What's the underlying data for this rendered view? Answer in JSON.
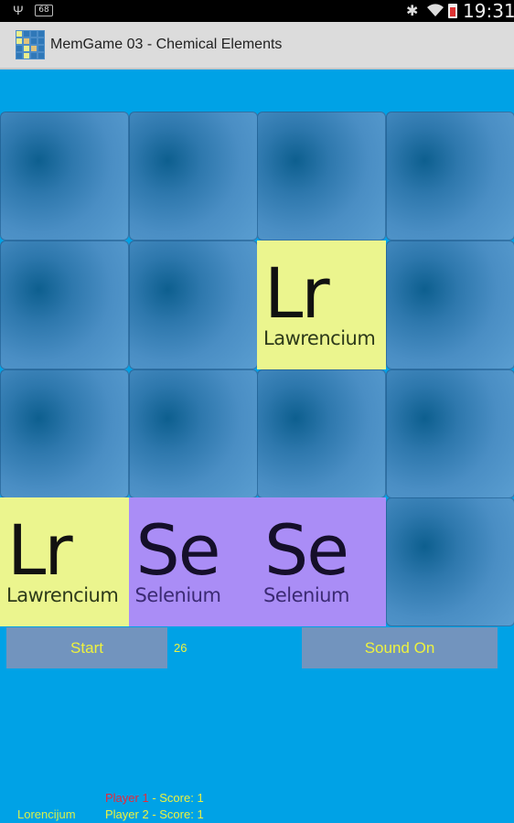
{
  "status_bar": {
    "notification_count": "68",
    "time": "19:31",
    "icons": [
      "usb-icon",
      "notification-icon",
      "bluetooth-icon",
      "wifi-icon",
      "battery-icon"
    ]
  },
  "app": {
    "title": "MemGame 03 - Chemical Elements",
    "icon": "app-icon"
  },
  "board": {
    "rows": 4,
    "cols": 4,
    "tiles": [
      {
        "row": 0,
        "col": 0,
        "state": "hidden"
      },
      {
        "row": 0,
        "col": 1,
        "state": "hidden"
      },
      {
        "row": 0,
        "col": 2,
        "state": "hidden"
      },
      {
        "row": 0,
        "col": 3,
        "state": "hidden"
      },
      {
        "row": 1,
        "col": 0,
        "state": "hidden"
      },
      {
        "row": 1,
        "col": 1,
        "state": "hidden"
      },
      {
        "row": 1,
        "col": 2,
        "state": "revealed",
        "symbol": "Lr",
        "name": "Lawrencium",
        "color": "#ebf58e"
      },
      {
        "row": 1,
        "col": 3,
        "state": "hidden"
      },
      {
        "row": 2,
        "col": 0,
        "state": "hidden"
      },
      {
        "row": 2,
        "col": 1,
        "state": "hidden"
      },
      {
        "row": 2,
        "col": 2,
        "state": "hidden"
      },
      {
        "row": 2,
        "col": 3,
        "state": "hidden"
      },
      {
        "row": 3,
        "col": 0,
        "state": "revealed",
        "symbol": "Lr",
        "name": "Lawrencium",
        "color": "#ebf58e"
      },
      {
        "row": 3,
        "col": 1,
        "state": "revealed",
        "symbol": "Se",
        "name": "Selenium",
        "color": "#aa8df6"
      },
      {
        "row": 3,
        "col": 2,
        "state": "revealed",
        "symbol": "Se",
        "name": "Selenium",
        "color": "#aa8df6"
      },
      {
        "row": 3,
        "col": 3,
        "state": "hidden"
      }
    ]
  },
  "controls": {
    "start_label": "Start",
    "counter": "26",
    "sound_label": "Sound On"
  },
  "footer": {
    "last_found": "Lorencijum",
    "player1": {
      "label": "Player 1",
      "score_text": " - Score: 1",
      "active": true
    },
    "player2": {
      "label": "Player 2",
      "score_text": " - Score: 1",
      "active": false
    }
  },
  "colors": {
    "background": "#00a2e6",
    "button_bg": "#7294be",
    "button_text": "#eef23e",
    "active_player": "#e8283a"
  }
}
